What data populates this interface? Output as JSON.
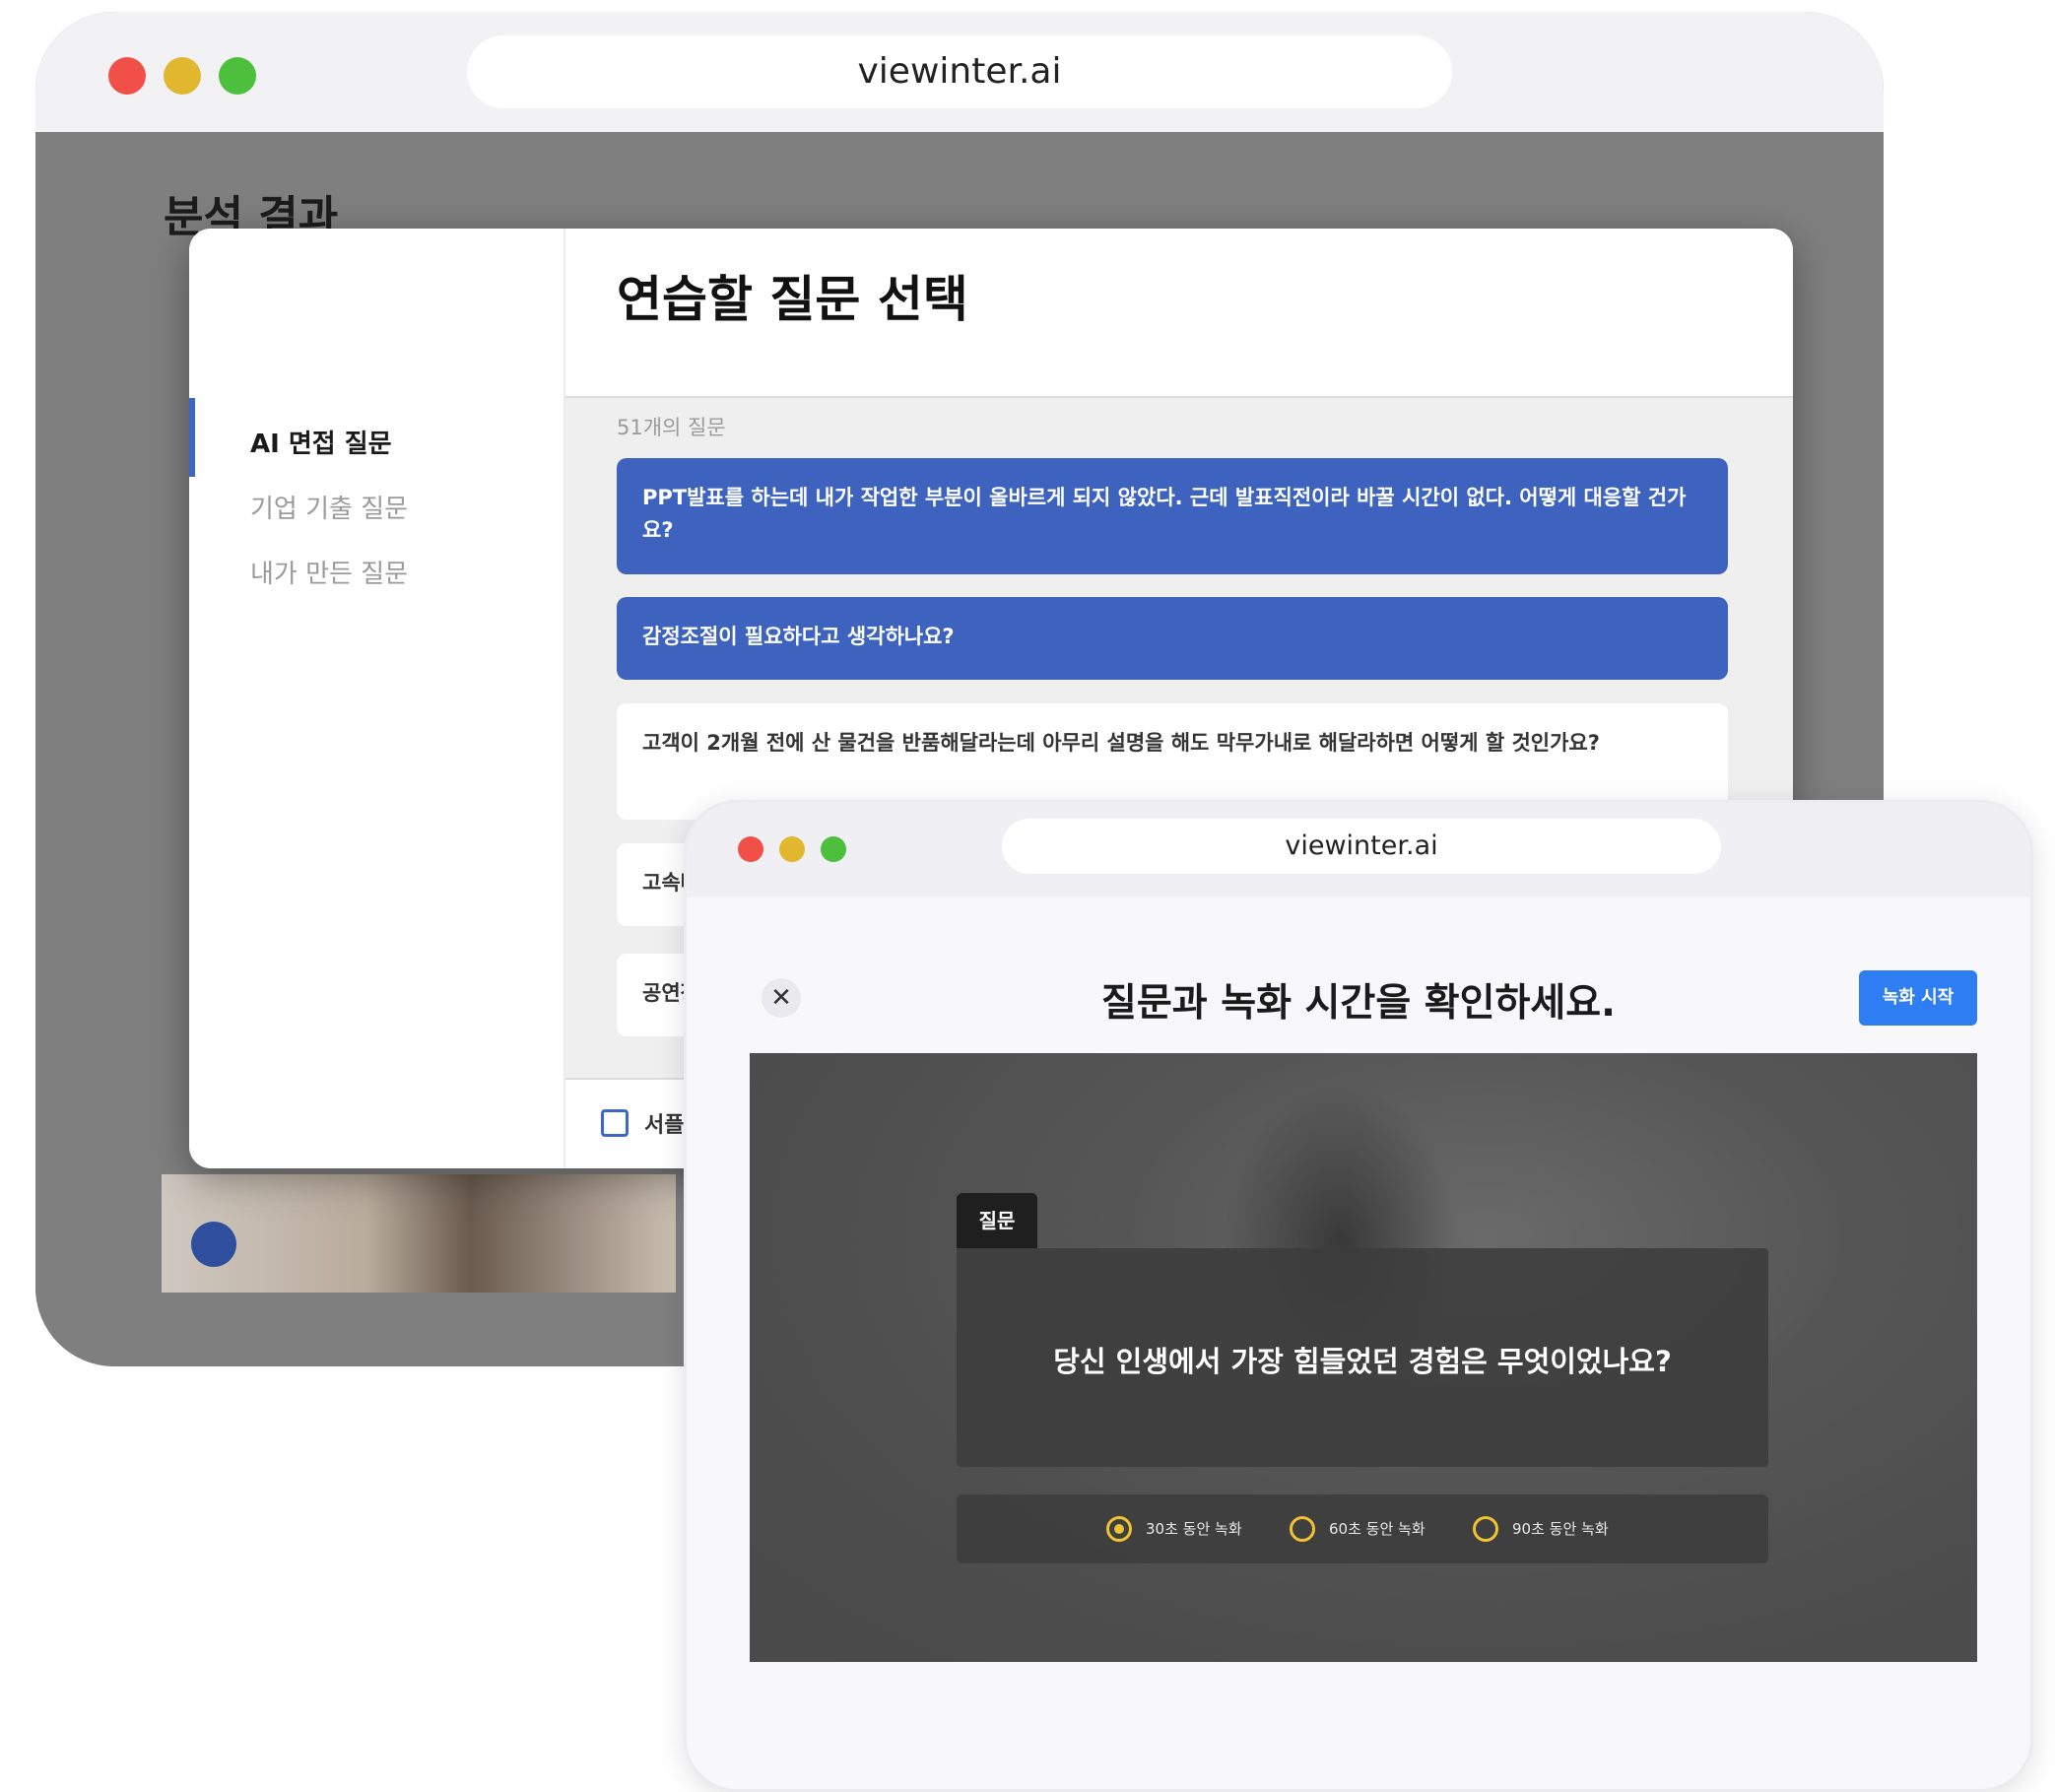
{
  "back_window": {
    "url": "viewinter.ai",
    "background_title": "분석 결과"
  },
  "modal": {
    "title": "연습할 질문 선택",
    "sidebar": [
      {
        "label": "AI 면접 질문",
        "active": true
      },
      {
        "label": "기업 기출 질문",
        "active": false
      },
      {
        "label": "내가 만든 질문",
        "active": false
      }
    ],
    "question_count": "51개의 질문",
    "questions": [
      {
        "text": "PPT발표를 하는데 내가 작업한 부분이 올바르게 되지 않았다. 근데 발표직전이라 바꿀 시간이 없다. 어떻게 대응할 건가요?",
        "selected": true
      },
      {
        "text": "감정조절이 필요하다고 생각하나요?",
        "selected": true
      },
      {
        "text": "고객이 2개월 전에 산 물건을 반품해달라는데 아무리 설명을 해도 막무가내로 해달라하면 어떻게 할 것인가요?",
        "selected": false
      },
      {
        "text": "고속버스",
        "selected": false
      },
      {
        "text": "공연장에",
        "selected": false
      }
    ],
    "footer_checkbox_label": "서플 기"
  },
  "front_window": {
    "url": "viewinter.ai",
    "title": "질문과 녹화 시간을 확인하세요.",
    "record_button": "녹화 시작",
    "question_tab": "질문",
    "question_text": "당신 인생에서 가장 힘들었던 경험은 무엇이었나요?",
    "options": [
      {
        "label": "30초 동안 녹화",
        "checked": true
      },
      {
        "label": "60초 동안 녹화",
        "checked": false
      },
      {
        "label": "90초 동안 녹화",
        "checked": false
      }
    ]
  },
  "colors": {
    "accent_blue": "#3e63bf",
    "record_blue": "#2f7df2",
    "radio_yellow": "#f1c232",
    "mac_red": "#f05048",
    "mac_yellow": "#e0b72f",
    "mac_green": "#4cbf3c"
  }
}
